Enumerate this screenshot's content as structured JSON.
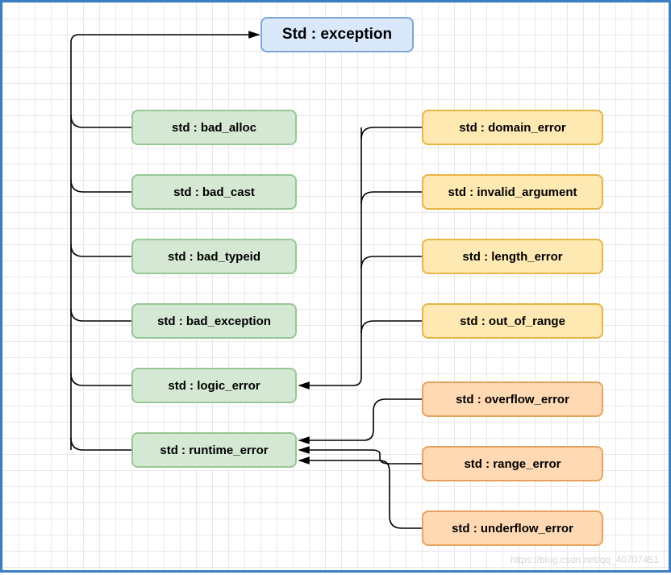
{
  "chart_data": {
    "type": "hierarchy-diagram",
    "title": "C++ std exception hierarchy",
    "root": {
      "id": "exception",
      "label": "Std : exception"
    },
    "children": [
      {
        "id": "bad_alloc",
        "label": "std : bad_alloc",
        "parent": "exception"
      },
      {
        "id": "bad_cast",
        "label": "std : bad_cast",
        "parent": "exception"
      },
      {
        "id": "bad_typeid",
        "label": "std : bad_typeid",
        "parent": "exception"
      },
      {
        "id": "bad_exception",
        "label": "std : bad_exception",
        "parent": "exception"
      },
      {
        "id": "logic_error",
        "label": "std : logic_error",
        "parent": "exception",
        "children": [
          {
            "id": "domain_error",
            "label": "std : domain_error",
            "parent": "logic_error"
          },
          {
            "id": "invalid_argument",
            "label": "std : invalid_argument",
            "parent": "logic_error"
          },
          {
            "id": "length_error",
            "label": "std : length_error",
            "parent": "logic_error"
          },
          {
            "id": "out_of_range",
            "label": "std : out_of_range",
            "parent": "logic_error"
          }
        ]
      },
      {
        "id": "runtime_error",
        "label": "std : runtime_error",
        "parent": "exception",
        "children": [
          {
            "id": "overflow_error",
            "label": "std : overflow_error",
            "parent": "runtime_error"
          },
          {
            "id": "range_error",
            "label": "std : range_error",
            "parent": "runtime_error"
          },
          {
            "id": "underflow_error",
            "label": "std : underflow_error",
            "parent": "runtime_error"
          }
        ]
      }
    ]
  },
  "nodes": {
    "exception": "Std : exception",
    "bad_alloc": "std : bad_alloc",
    "bad_cast": "std : bad_cast",
    "bad_typeid": "std : bad_typeid",
    "bad_exception": "std : bad_exception",
    "logic_error": "std : logic_error",
    "runtime_error": "std : runtime_error",
    "domain_error": "std : domain_error",
    "invalid_argument": "std : invalid_argument",
    "length_error": "std : length_error",
    "out_of_range": "std : out_of_range",
    "overflow_error": "std : overflow_error",
    "range_error": "std : range_error",
    "underflow_error": "std : underflow_error"
  },
  "watermark": "https://blog.csdn.net/qq_40707451"
}
